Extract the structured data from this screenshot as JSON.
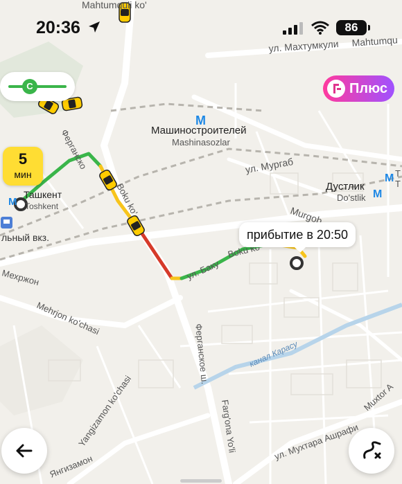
{
  "status_bar": {
    "time": "20:36",
    "battery": "86"
  },
  "map_labels": {
    "street_makhtumkuli": "ул. Махтумкули",
    "street_makhtumkuli_latin": "Mahtumqu",
    "street_mahtumquli_top": "Mahtumquli ko'",
    "metro_mashinostroiteley": "Машиностроителей",
    "metro_mashinasozlar": "Mashinasozlar",
    "street_murgab": "ул. Мургаб",
    "street_murgob": "Murgob",
    "metro_dustlik": "Дустлик",
    "metro_dostlik": "Do'stlik",
    "station_tashkent": "Ташкент",
    "station_toshkent": "Toshkent",
    "station_vkz": "льный вкз.",
    "street_fergana_ru": "Ферганско",
    "street_fargona_uz": "Farg'ona Yo'li",
    "street_baku": "ул. Баку",
    "street_boku": "Boku ko'",
    "street_mehrjon_ru": "Мехржон",
    "street_mehrjon_uz": "Mehrjon ko'chasi",
    "street_fergana_sh": "Ферганское ш.",
    "canal_karasu": "канал Карасу",
    "street_yangizamon": "Yangizamon ko'chasi",
    "street_yangizamon_ru": "Янгизамон",
    "street_ashrafi": "ул. Мухтара Ашрафи",
    "street_muxtor": "Muxtor A",
    "edge_t1": "Т",
    "edge_t2": "Т"
  },
  "metro_pill": {
    "letter": "C"
  },
  "plus_badge": {
    "label": "Плюс"
  },
  "eta_badge": {
    "value": "5",
    "unit": "мин"
  },
  "arrival_bubble": {
    "text": "прибытие в 20:50"
  },
  "icons": {
    "back": "arrow-left-icon",
    "route": "route-icon",
    "location": "location-arrow-icon",
    "metro": "metro-m-icon",
    "taxi": "taxi-car-icon",
    "rail": "train-icon"
  },
  "colors": {
    "map_bg": "#f2f0eb",
    "route_green": "#3ab54a",
    "route_yellow": "#f7c41c",
    "route_red": "#d63a2a",
    "metro": "#1e88e5",
    "taxi": "#ffcc00",
    "plus_gradient_start": "#ff3a9d",
    "plus_gradient_end": "#a052ff"
  }
}
